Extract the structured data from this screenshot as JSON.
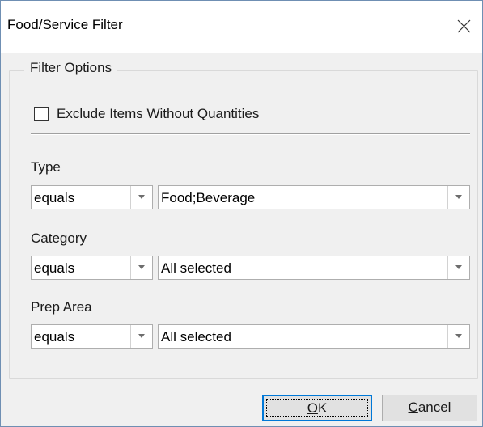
{
  "window": {
    "title": "Food/Service Filter",
    "close_icon": "close-icon"
  },
  "filter_options": {
    "legend": "Filter Options",
    "exclude_checkbox": {
      "label": "Exclude Items Without Quantities",
      "checked": false
    },
    "fields": [
      {
        "label": "Type",
        "operator": "equals",
        "value": "Food;Beverage"
      },
      {
        "label": "Category",
        "operator": "equals",
        "value": "All selected"
      },
      {
        "label": "Prep Area",
        "operator": "equals",
        "value": "All selected"
      }
    ]
  },
  "buttons": {
    "ok": {
      "accel": "O",
      "rest": "K"
    },
    "cancel": {
      "accel": "C",
      "rest": "ancel"
    }
  },
  "colors": {
    "window_border": "#6f8fb3",
    "dialog_bg": "#f0f0f0",
    "default_button_border": "#0078d7"
  }
}
